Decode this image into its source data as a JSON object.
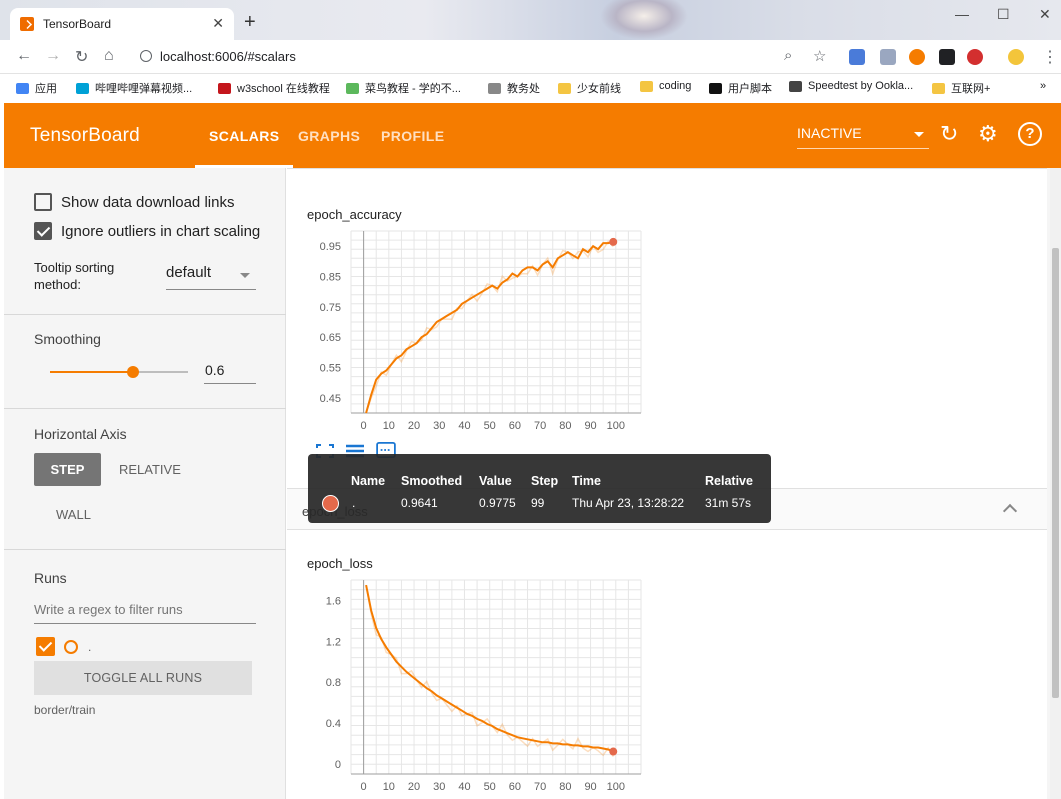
{
  "browser": {
    "tab_title": "TensorBoard",
    "url": "localhost:6006/#scalars",
    "bookmarks": [
      "应用",
      "哔哩哔哩弹幕视频...",
      "w3school 在线教程",
      "菜鸟教程 - 学的不...",
      "教务处",
      "少女前线",
      "coding",
      "用户脚本",
      "Speedtest by Ookla...",
      "互联网+"
    ],
    "bookmark_colors": [
      "#4285f4",
      "#00a1d6",
      "#c4161c",
      "#5cb85c",
      "#888888",
      "#f4c542",
      "#f4c542",
      "#111111",
      "#444444",
      "#f4c542"
    ],
    "accent": "#f57c00"
  },
  "header": {
    "logo": "TensorBoard",
    "tabs": [
      "SCALARS",
      "GRAPHS",
      "PROFILE"
    ],
    "status_select": "INACTIVE"
  },
  "sidebar": {
    "show_download_links": "Show data download links",
    "ignore_outliers": "Ignore outliers in chart scaling",
    "tooltip_sort_label_1": "Tooltip sorting",
    "tooltip_sort_label_2": "method:",
    "tooltip_sort_value": "default",
    "smoothing_label": "Smoothing",
    "smoothing_value": "0.6",
    "smoothing_fraction": 0.6,
    "horizontal_axis_label": "Horizontal Axis",
    "axis_options": [
      "STEP",
      "RELATIVE",
      "WALL"
    ],
    "runs_label": "Runs",
    "regex_placeholder": "Write a regex to filter runs",
    "run_label": ".",
    "toggle_runs": "TOGGLE ALL RUNS",
    "run_group": "border/train"
  },
  "cards": {
    "accuracy_title": "epoch_accuracy",
    "loss_title": "epoch_loss",
    "group_title": "epoch_loss"
  },
  "tooltip": {
    "headers": [
      "Name",
      "Smoothed",
      "Value",
      "Step",
      "Time",
      "Relative"
    ],
    "name": ".",
    "smoothed": "0.9641",
    "value": "0.9775",
    "step": "99",
    "time": "Thu Apr 23, 13:28:22",
    "relative": "31m 57s"
  },
  "chart_data": [
    {
      "type": "line",
      "title": "epoch_accuracy",
      "x_ticks": [
        0,
        10,
        20,
        30,
        40,
        50,
        60,
        70,
        80,
        90,
        100
      ],
      "y_ticks": [
        "0.45",
        "0.55",
        "0.65",
        "0.75",
        "0.85",
        "0.95"
      ],
      "xlim": [
        -5,
        110
      ],
      "ylim": [
        0.4,
        1.0
      ],
      "color": "#f57c00",
      "x": [
        1,
        3,
        5,
        7,
        9,
        11,
        13,
        15,
        17,
        19,
        21,
        23,
        25,
        27,
        29,
        31,
        33,
        35,
        37,
        39,
        41,
        43,
        45,
        47,
        49,
        51,
        53,
        55,
        57,
        59,
        61,
        63,
        65,
        67,
        69,
        71,
        73,
        75,
        77,
        79,
        81,
        83,
        85,
        87,
        89,
        91,
        93,
        95,
        97,
        99
      ],
      "values": [
        0.4,
        0.46,
        0.51,
        0.53,
        0.54,
        0.56,
        0.58,
        0.59,
        0.61,
        0.62,
        0.63,
        0.65,
        0.66,
        0.68,
        0.7,
        0.71,
        0.72,
        0.73,
        0.74,
        0.76,
        0.77,
        0.78,
        0.79,
        0.8,
        0.81,
        0.82,
        0.81,
        0.83,
        0.84,
        0.86,
        0.85,
        0.87,
        0.88,
        0.88,
        0.87,
        0.89,
        0.9,
        0.88,
        0.91,
        0.92,
        0.93,
        0.92,
        0.91,
        0.94,
        0.93,
        0.95,
        0.94,
        0.96,
        0.96,
        0.964
      ]
    },
    {
      "type": "line",
      "title": "epoch_loss",
      "x_ticks": [
        0,
        10,
        20,
        30,
        40,
        50,
        60,
        70,
        80,
        90,
        100
      ],
      "y_ticks": [
        "0",
        "0.4",
        "0.8",
        "1.2",
        "1.6"
      ],
      "xlim": [
        -5,
        110
      ],
      "ylim": [
        -0.1,
        1.8
      ],
      "color": "#f57c00",
      "x": [
        1,
        3,
        5,
        7,
        9,
        11,
        13,
        15,
        17,
        19,
        21,
        23,
        25,
        27,
        29,
        31,
        33,
        35,
        37,
        39,
        41,
        43,
        45,
        47,
        49,
        51,
        53,
        55,
        57,
        59,
        61,
        63,
        65,
        67,
        69,
        71,
        73,
        75,
        77,
        79,
        81,
        83,
        85,
        87,
        89,
        91,
        93,
        95,
        97,
        99
      ],
      "values": [
        1.75,
        1.5,
        1.33,
        1.22,
        1.14,
        1.07,
        1.0,
        0.95,
        0.9,
        0.86,
        0.82,
        0.78,
        0.74,
        0.71,
        0.67,
        0.64,
        0.61,
        0.58,
        0.55,
        0.52,
        0.49,
        0.47,
        0.44,
        0.42,
        0.39,
        0.37,
        0.34,
        0.32,
        0.3,
        0.28,
        0.26,
        0.25,
        0.24,
        0.23,
        0.22,
        0.21,
        0.21,
        0.2,
        0.2,
        0.19,
        0.19,
        0.18,
        0.18,
        0.17,
        0.17,
        0.16,
        0.16,
        0.15,
        0.14,
        0.12
      ]
    }
  ]
}
